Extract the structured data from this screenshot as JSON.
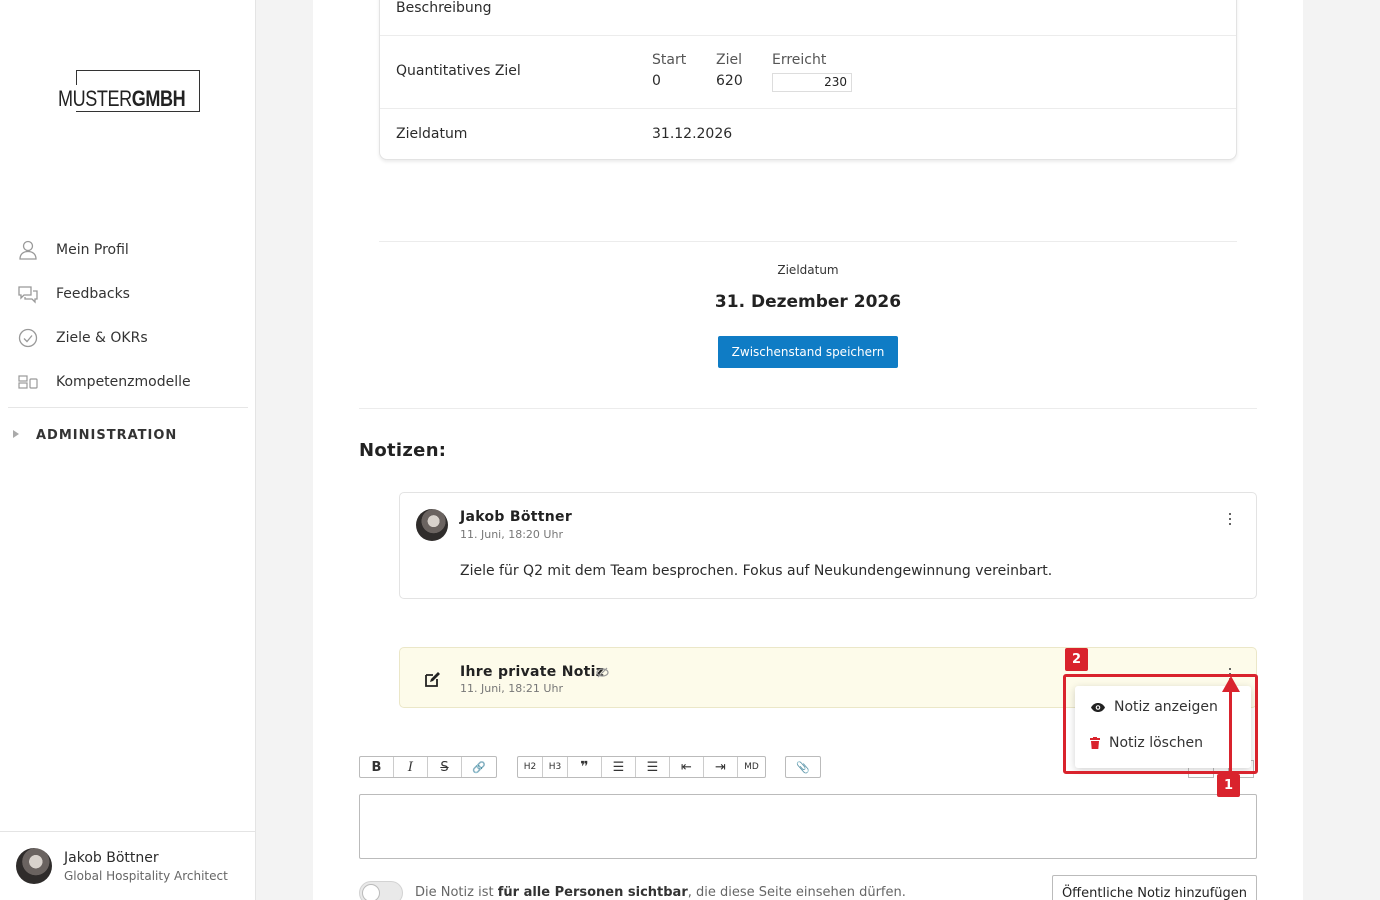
{
  "sidebar": {
    "logo": "MUSTERGMBH",
    "logo_light": "MUSTER",
    "logo_bold": "GMBH",
    "items": [
      {
        "label": "Mein Profil",
        "icon": "user-icon"
      },
      {
        "label": "Feedbacks",
        "icon": "chat-icon"
      },
      {
        "label": "Ziele & OKRs",
        "icon": "check-circle-icon"
      },
      {
        "label": "Kompetenzmodelle",
        "icon": "grid-icon"
      }
    ],
    "admin_label": "ADMINISTRATION",
    "user": {
      "name": "Jakob Böttner",
      "role": "Global Hospitality Architect"
    }
  },
  "goal": {
    "description_label": "Beschreibung",
    "quant_label": "Quantitatives Ziel",
    "start_label": "Start",
    "start_value": "0",
    "target_label": "Ziel",
    "target_value": "620",
    "reached_label": "Erreicht",
    "reached_value": "230",
    "date_label": "Zieldatum",
    "date_value": "31.12.2026"
  },
  "summary": {
    "date_label": "Zieldatum",
    "date_value": "31. Dezember 2026",
    "save_button": "Zwischenstand speichern"
  },
  "notes": {
    "title": "Notizen:",
    "items": [
      {
        "author": "Jakob Böttner",
        "time": "11. Juni, 18:20 Uhr",
        "text": "Ziele für Q2 mit dem Team besprochen. Fokus auf Neukundengewinnung vereinbart."
      },
      {
        "author": "Ihre private Notiz",
        "time": "11. Juni, 18:21 Uhr"
      }
    ],
    "menu": {
      "show": "Notiz anzeigen",
      "delete": "Notiz löschen"
    }
  },
  "toolbar": {
    "bold": "B",
    "italic": "I",
    "strike": "S",
    "link": "🔗",
    "h2": "H2",
    "h3": "H3",
    "quote": "❞",
    "ul": "☰",
    "ol": "☰",
    "outdent": "⇤",
    "indent": "⇥",
    "md": "MD",
    "attach": "📎"
  },
  "composer": {
    "visibility_prefix": "Die Notiz ist ",
    "visibility_bold": "für alle Personen sichtbar",
    "visibility_suffix": ", die diese Seite einsehen dürfen.",
    "public_button": "Öffentliche Notiz hinzufügen"
  },
  "annotations": {
    "badge1": "1",
    "badge2": "2"
  },
  "colors": {
    "primary": "#0f7cc5",
    "highlight": "#d9232d",
    "private_bg": "#fdfbea",
    "delete": "#d9232d"
  }
}
